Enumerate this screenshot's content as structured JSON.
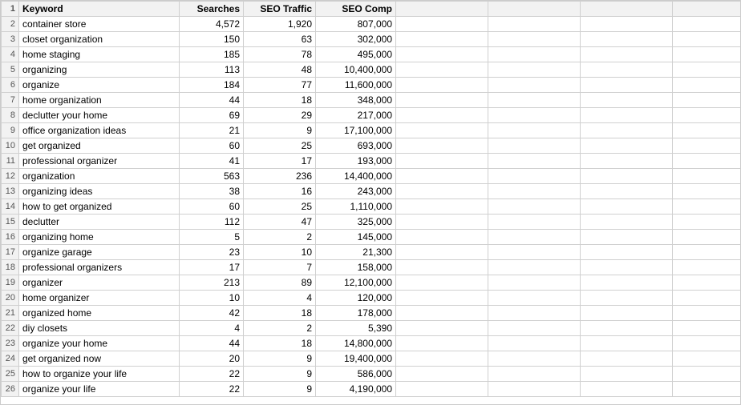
{
  "columns": {
    "row_num": "#",
    "keyword": "Keyword",
    "searches": "Searches",
    "seo_traffic": "SEO Traffic",
    "seo_comp": "SEO Comp",
    "extra1": "",
    "extra2": "",
    "extra3": ""
  },
  "rows": [
    {
      "num": 2,
      "keyword": "container store",
      "searches": 4572,
      "seo_traffic": 1920,
      "seo_comp": 807000
    },
    {
      "num": 3,
      "keyword": "closet organization",
      "searches": 150,
      "seo_traffic": 63,
      "seo_comp": 302000
    },
    {
      "num": 4,
      "keyword": "home staging",
      "searches": 185,
      "seo_traffic": 78,
      "seo_comp": 495000
    },
    {
      "num": 5,
      "keyword": "organizing",
      "searches": 113,
      "seo_traffic": 48,
      "seo_comp": 10400000
    },
    {
      "num": 6,
      "keyword": "organize",
      "searches": 184,
      "seo_traffic": 77,
      "seo_comp": 11600000
    },
    {
      "num": 7,
      "keyword": "home organization",
      "searches": 44,
      "seo_traffic": 18,
      "seo_comp": 348000
    },
    {
      "num": 8,
      "keyword": "declutter your home",
      "searches": 69,
      "seo_traffic": 29,
      "seo_comp": 217000
    },
    {
      "num": 9,
      "keyword": "office organization ideas",
      "searches": 21,
      "seo_traffic": 9,
      "seo_comp": 17100000
    },
    {
      "num": 10,
      "keyword": "get organized",
      "searches": 60,
      "seo_traffic": 25,
      "seo_comp": 693000
    },
    {
      "num": 11,
      "keyword": "professional organizer",
      "searches": 41,
      "seo_traffic": 17,
      "seo_comp": 193000
    },
    {
      "num": 12,
      "keyword": "organization",
      "searches": 563,
      "seo_traffic": 236,
      "seo_comp": 14400000
    },
    {
      "num": 13,
      "keyword": "organizing ideas",
      "searches": 38,
      "seo_traffic": 16,
      "seo_comp": 243000
    },
    {
      "num": 14,
      "keyword": "how to get organized",
      "searches": 60,
      "seo_traffic": 25,
      "seo_comp": 1110000
    },
    {
      "num": 15,
      "keyword": "declutter",
      "searches": 112,
      "seo_traffic": 47,
      "seo_comp": 325000
    },
    {
      "num": 16,
      "keyword": "organizing home",
      "searches": 5,
      "seo_traffic": 2,
      "seo_comp": 145000
    },
    {
      "num": 17,
      "keyword": "organize garage",
      "searches": 23,
      "seo_traffic": 10,
      "seo_comp": 21300
    },
    {
      "num": 18,
      "keyword": "professional organizers",
      "searches": 17,
      "seo_traffic": 7,
      "seo_comp": 158000
    },
    {
      "num": 19,
      "keyword": "organizer",
      "searches": 213,
      "seo_traffic": 89,
      "seo_comp": 12100000
    },
    {
      "num": 20,
      "keyword": "home organizer",
      "searches": 10,
      "seo_traffic": 4,
      "seo_comp": 120000
    },
    {
      "num": 21,
      "keyword": "organized home",
      "searches": 42,
      "seo_traffic": 18,
      "seo_comp": 178000
    },
    {
      "num": 22,
      "keyword": "diy closets",
      "searches": 4,
      "seo_traffic": 2,
      "seo_comp": 5390
    },
    {
      "num": 23,
      "keyword": "organize your home",
      "searches": 44,
      "seo_traffic": 18,
      "seo_comp": 14800000
    },
    {
      "num": 24,
      "keyword": "get organized now",
      "searches": 20,
      "seo_traffic": 9,
      "seo_comp": 19400000
    },
    {
      "num": 25,
      "keyword": "how to organize your life",
      "searches": 22,
      "seo_traffic": 9,
      "seo_comp": 586000
    },
    {
      "num": 26,
      "keyword": "organize your life",
      "searches": 22,
      "seo_traffic": 9,
      "seo_comp": 4190000
    }
  ],
  "highlighted_rows": [
    3,
    11,
    13,
    14,
    25
  ],
  "colors": {
    "header_bg": "#f2f2f2",
    "row_num_bg": "#f2f2f2",
    "border": "#d0d0d0",
    "highlight_text": "#000000"
  }
}
